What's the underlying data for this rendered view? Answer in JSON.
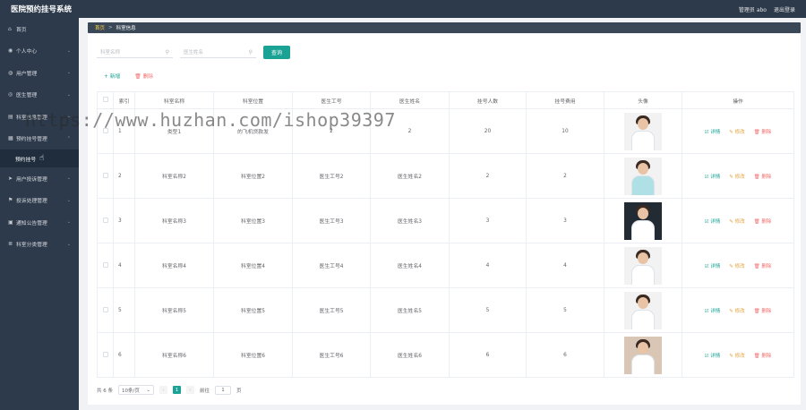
{
  "header": {
    "title": "医院预约挂号系统",
    "user_label": "管理员 abo",
    "logout_label": "退出登录"
  },
  "sidebar": {
    "items": [
      {
        "label": "首页",
        "icon": "home-icon",
        "glyph": "⌂",
        "has_children": false
      },
      {
        "label": "个人中心",
        "icon": "user-icon",
        "glyph": "◉",
        "has_children": true
      },
      {
        "label": "用户管理",
        "icon": "user-group-icon",
        "glyph": "◍",
        "has_children": true
      },
      {
        "label": "医生管理",
        "icon": "doctor-icon",
        "glyph": "◎",
        "has_children": true
      },
      {
        "label": "科室信息管理",
        "icon": "building-icon",
        "glyph": "▤",
        "has_children": true
      },
      {
        "label": "预约挂号管理",
        "icon": "calendar-icon",
        "glyph": "▦",
        "has_children": true,
        "open": true,
        "children": [
          {
            "label": "预约挂号"
          }
        ]
      },
      {
        "label": "用户投诉管理",
        "icon": "send-icon",
        "glyph": "➤",
        "has_children": true
      },
      {
        "label": "投诉处理管理",
        "icon": "flag-icon",
        "glyph": "⚑",
        "has_children": true
      },
      {
        "label": "通知公告管理",
        "icon": "notice-icon",
        "glyph": "▣",
        "has_children": true
      },
      {
        "label": "科室分类管理",
        "icon": "list-icon",
        "glyph": "≣",
        "has_children": true
      }
    ]
  },
  "breadcrumb": {
    "home": "首页",
    "separator": ">",
    "current": "科室信息"
  },
  "search": {
    "dept_placeholder": "科室名称",
    "doctor_placeholder": "医生姓名",
    "button_label": "查询"
  },
  "actions": {
    "add_label": "+ 新增",
    "delete_label": "🗑 删除"
  },
  "table": {
    "columns": [
      "",
      "索引",
      "科室名称",
      "科室位置",
      "医生工号",
      "医生姓名",
      "挂号人数",
      "挂号费用",
      "头像",
      "操作"
    ],
    "rows": [
      {
        "index": "1",
        "dept_name": "类型1",
        "dept_location": "的飞机贷款发",
        "doctor_id": "2",
        "doctor_name": "2",
        "reg_count": "20",
        "reg_fee": "10",
        "avatar": "doctor-avatar-icon"
      },
      {
        "index": "2",
        "dept_name": "科室名称2",
        "dept_location": "科室位置2",
        "doctor_id": "医生工号2",
        "doctor_name": "医生姓名2",
        "reg_count": "2",
        "reg_fee": "2",
        "avatar": "doctor-avatar-icon"
      },
      {
        "index": "3",
        "dept_name": "科室名称3",
        "dept_location": "科室位置3",
        "doctor_id": "医生工号3",
        "doctor_name": "医生姓名3",
        "reg_count": "3",
        "reg_fee": "3",
        "avatar": "doctor-avatar-icon"
      },
      {
        "index": "4",
        "dept_name": "科室名称4",
        "dept_location": "科室位置4",
        "doctor_id": "医生工号4",
        "doctor_name": "医生姓名4",
        "reg_count": "4",
        "reg_fee": "4",
        "avatar": "doctor-avatar-icon"
      },
      {
        "index": "5",
        "dept_name": "科室名称5",
        "dept_location": "科室位置5",
        "doctor_id": "医生工号5",
        "doctor_name": "医生姓名5",
        "reg_count": "5",
        "reg_fee": "5",
        "avatar": "doctor-avatar-icon"
      },
      {
        "index": "6",
        "dept_name": "科室名称6",
        "dept_location": "科室位置6",
        "doctor_id": "医生工号6",
        "doctor_name": "医生姓名6",
        "reg_count": "6",
        "reg_fee": "6",
        "avatar": "doctor-avatar-icon"
      }
    ],
    "ops": {
      "detail": "☑ 详情",
      "edit": "✎ 修改",
      "delete": "🗑 删除"
    }
  },
  "pagination": {
    "total": "共 6 条",
    "page_size": "10条/页",
    "current": "1",
    "goto_label": "前往",
    "goto_value": "1",
    "page_suffix": "页"
  },
  "watermark": "https://www.huzhan.com/ishop39397",
  "colors": {
    "accent": "#1aa394",
    "sidebar": "#2d3a4b",
    "danger": "#f56c6c",
    "warning": "#e6a23c"
  }
}
